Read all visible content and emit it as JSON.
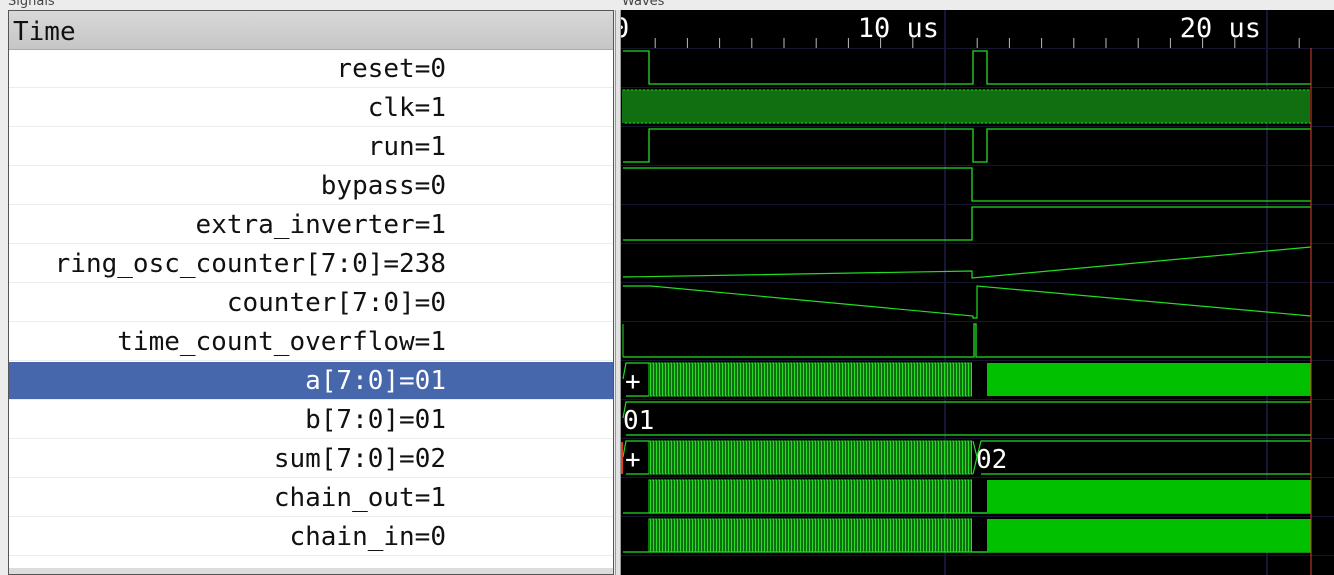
{
  "panels": {
    "signals_title": "Signals",
    "waves_title": "Waves"
  },
  "signals_header": "Time",
  "signals": [
    {
      "label": "reset=0"
    },
    {
      "label": "clk=1"
    },
    {
      "label": "run=1"
    },
    {
      "label": "bypass=0"
    },
    {
      "label": "extra_inverter=1"
    },
    {
      "label": "ring_osc_counter[7:0]=238"
    },
    {
      "label": "counter[7:0]=0"
    },
    {
      "label": "time_count_overflow=1"
    },
    {
      "label": "a[7:0]=01",
      "selected": true
    },
    {
      "label": "b[7:0]=01"
    },
    {
      "label": "sum[7:0]=02"
    },
    {
      "label": "chain_out=1"
    },
    {
      "label": "chain_in=0"
    }
  ],
  "timeline": {
    "start_label": "0",
    "ticks": [
      "10 us",
      "20 us"
    ]
  },
  "bus_values": {
    "a_start": "+",
    "b_value": "01",
    "sum_start": "+",
    "sum_end": "02"
  },
  "colors": {
    "wave": "#22dd22",
    "bus_fill": "#00c000",
    "grid": "#2c2c70",
    "selection": "#4767ad",
    "marker": "#e04020"
  }
}
